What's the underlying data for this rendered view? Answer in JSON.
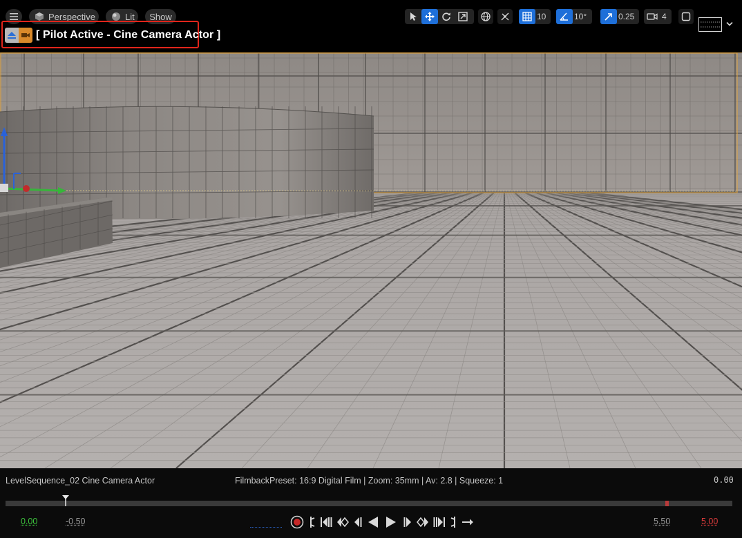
{
  "toolbar": {
    "menu_icon": "hamburger-menu-icon",
    "view_mode": "Perspective",
    "lighting_mode": "Lit",
    "show_label": "Show",
    "grid_snap_value": "10",
    "rotation_snap_value": "10°",
    "scale_snap_value": "0.25",
    "camera_speed_value": "4"
  },
  "pilot": {
    "label": "[ Pilot Active - Cine Camera Actor ]",
    "highlight_color": "#e1251b"
  },
  "info": {
    "sequence_name": "LevelSequence_02  Cine Camera Actor",
    "filmback": "FilmbackPreset: 16:9 Digital Film | Zoom: 35mm | Av: 2.8 | Squeeze: 1",
    "current_time": "0.00"
  },
  "timeline": {
    "start_value": "0.00",
    "view_start_value": "-0.50",
    "view_end_value": "5.50",
    "end_value": "5.00",
    "start_color": "#3cc23c",
    "end_color": "#e03c3c",
    "accent_color": "#1e6fd9"
  }
}
